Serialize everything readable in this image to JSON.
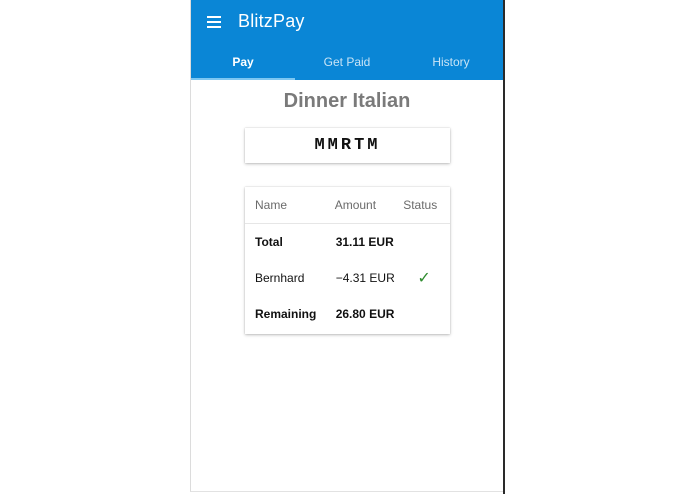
{
  "app": {
    "title": "BlitzPay",
    "menu_icon": "hamburger-menu-icon",
    "colors": {
      "primary": "#0a86d6",
      "tab_indicator": "#7cc7f2",
      "check": "#2e8b2e"
    }
  },
  "tabs": [
    {
      "label": "Pay",
      "active": true
    },
    {
      "label": "Get Paid",
      "active": false
    },
    {
      "label": "History",
      "active": false
    }
  ],
  "bill": {
    "title": "Dinner Italian",
    "code": "MMRTM"
  },
  "table": {
    "headers": {
      "name": "Name",
      "amount": "Amount",
      "status": "Status"
    },
    "rows": [
      {
        "name": "Total",
        "amount": "31.11 EUR",
        "status": "",
        "bold": true
      },
      {
        "name": "Bernhard",
        "amount": "−4.31 EUR",
        "status": "✓",
        "status_icon": "checkmark-icon",
        "bold": false
      },
      {
        "name": "Remaining",
        "amount": "26.80 EUR",
        "status": "",
        "bold": true
      }
    ]
  }
}
